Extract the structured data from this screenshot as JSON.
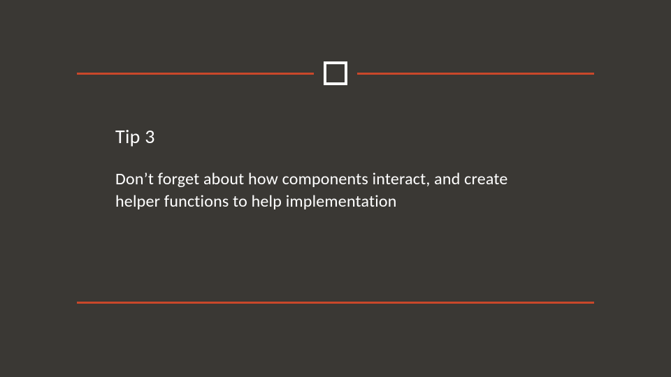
{
  "slide": {
    "title": "Tip 3",
    "body": "Don’t forget about how components interact, and create helper functions to help implementation"
  },
  "theme": {
    "background": "#3a3834",
    "accent": "#c9482a",
    "text": "#ffffff",
    "icon_border": "#ffffff"
  }
}
